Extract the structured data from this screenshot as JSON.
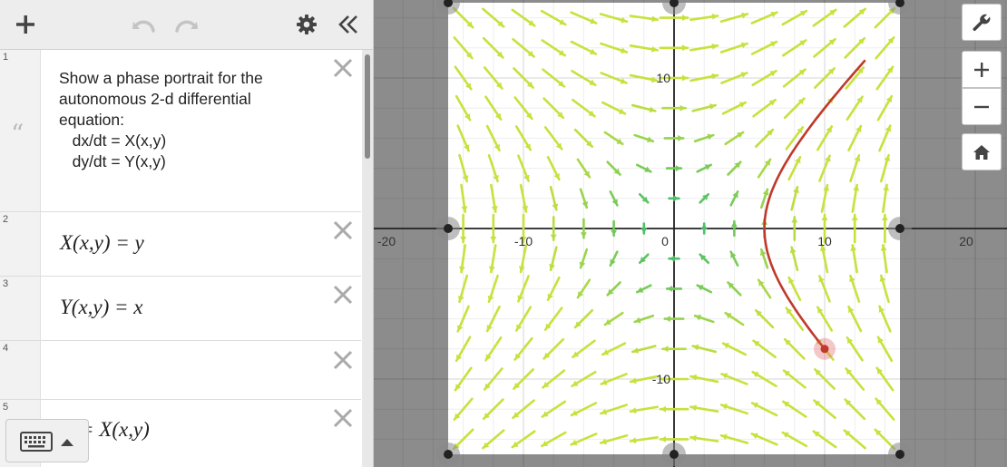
{
  "toolbar": {
    "add_icon": "plus-icon",
    "undo_icon": "undo-icon",
    "redo_icon": "redo-icon",
    "settings_icon": "gear-icon",
    "collapse_icon": "double-chevron-left-icon"
  },
  "expressions": [
    {
      "index": "1",
      "type": "note",
      "text": "Show a phase portrait for the\nautonomous 2-d differential\nequation:\n   dx/dt = X(x,y)\n   dy/dt = Y(x,y)"
    },
    {
      "index": "2",
      "type": "math",
      "text": "X(x,y) = y"
    },
    {
      "index": "3",
      "type": "math",
      "text": "Y(x,y) = x"
    },
    {
      "index": "4",
      "type": "empty",
      "text": ""
    },
    {
      "index": "5",
      "type": "math",
      "text": "= X(x,y)"
    }
  ],
  "graph": {
    "x_ticks": [
      "-20",
      "-10",
      "0",
      "10",
      "20"
    ],
    "y_ticks": [
      "10",
      "-10"
    ],
    "xlim": [
      -20,
      20
    ],
    "ylim": [
      -15.5,
      15.5
    ],
    "field_region": {
      "x": [
        -15,
        15
      ],
      "y": [
        -15,
        15
      ]
    },
    "trajectory_start": [
      10,
      -8
    ],
    "colors": {
      "field_outer": "#c8e13c",
      "field_inner": "#2bb673",
      "trajectory": "#c0392b"
    }
  },
  "right_toolbar": {
    "wrench_icon": "wrench-icon",
    "zoom_in_icon": "plus-icon",
    "zoom_out_icon": "minus-icon",
    "home_icon": "home-icon"
  },
  "keyboard": {
    "icon": "keyboard-icon",
    "toggle": "caret-up-icon"
  }
}
